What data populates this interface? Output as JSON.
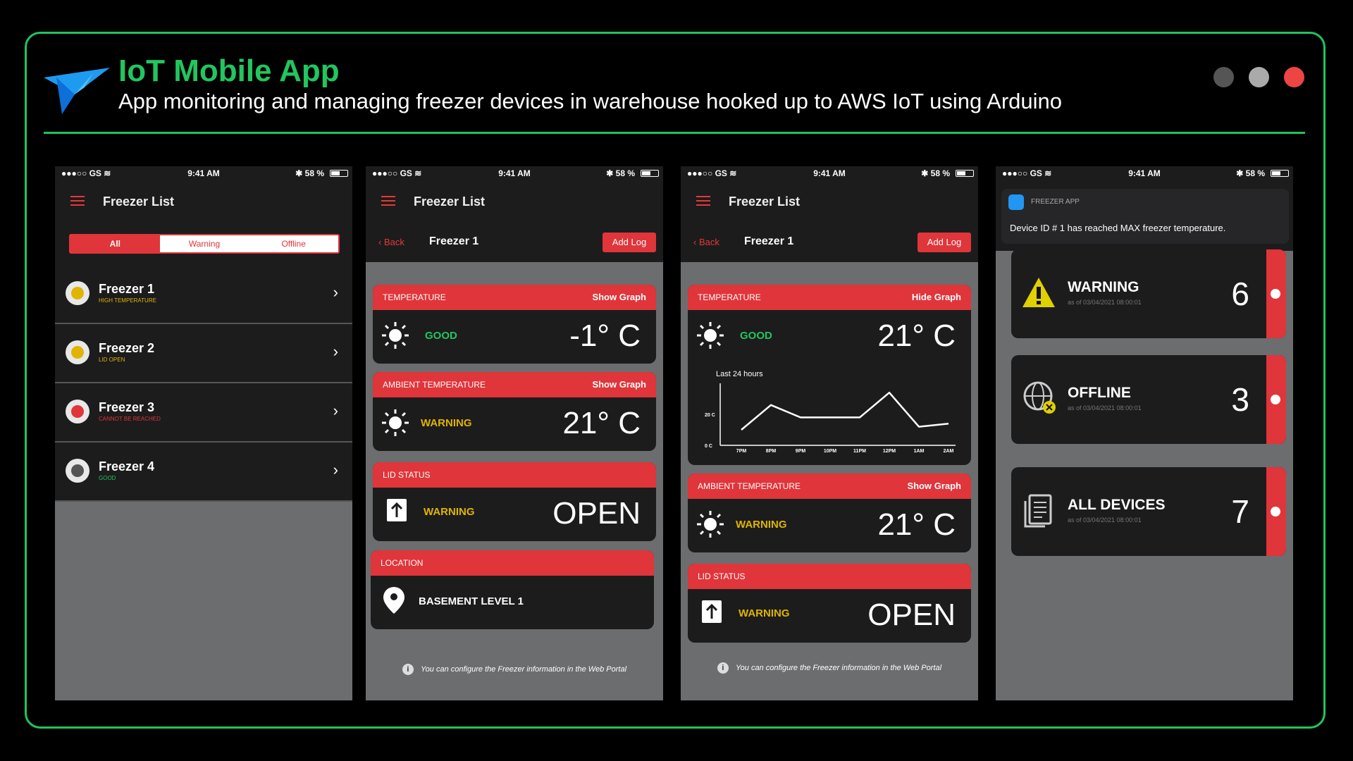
{
  "header": {
    "title": "IoT Mobile App",
    "subtitle": "App monitoring and managing freezer devices in warehouse hooked up to AWS IoT using Arduino",
    "accent_color": "#22c55e",
    "window_dots": [
      "#555555",
      "#aaaaaa",
      "#ef4444"
    ]
  },
  "statusbar": {
    "carrier": "●●●○○ GS ≋",
    "time": "9:41 AM",
    "battery": "✱ 58 %"
  },
  "screen1": {
    "nav_title": "Freezer List",
    "segments": [
      "All",
      "Warning",
      "Offline"
    ],
    "freezers": [
      {
        "name": "Freezer 1",
        "status": "HIGH TEMPERATURE",
        "status_color": "#e0b400",
        "icon": "warning-icon"
      },
      {
        "name": "Freezer 2",
        "status": "LID OPEN",
        "status_color": "#e0b400",
        "icon": "warning-icon"
      },
      {
        "name": "Freezer 3",
        "status": "CANNOT BE REACHED",
        "status_color": "#e0353a",
        "icon": "offline-icon"
      },
      {
        "name": "Freezer 4",
        "status": "GOOD",
        "status_color": "#22c55e",
        "icon": "check-icon"
      }
    ]
  },
  "detail": {
    "nav_title": "Freezer List",
    "back": "Back",
    "device": "Freezer 1",
    "add_log": "Add Log",
    "info": "You can configure the Freezer information in the Web Portal"
  },
  "screen2": {
    "temperature": {
      "title": "TEMPERATURE",
      "graph_label": "Show Graph",
      "status": "GOOD",
      "value": "-1° C"
    },
    "ambient": {
      "title": "AMBIENT TEMPERATURE",
      "graph_label": "Show Graph",
      "status": "WARNING",
      "value": "21° C"
    },
    "lid": {
      "title": "LID STATUS",
      "status": "WARNING",
      "value": "OPEN"
    },
    "location": {
      "title": "LOCATION",
      "value": "BASEMENT LEVEL 1"
    }
  },
  "screen3": {
    "temperature": {
      "title": "TEMPERATURE",
      "graph_label": "Hide Graph",
      "status": "GOOD",
      "value": "21° C"
    },
    "ambient": {
      "title": "AMBIENT TEMPERATURE",
      "graph_label": "Show Graph",
      "status": "WARNING",
      "value": "21° C"
    },
    "lid": {
      "title": "LID STATUS",
      "status": "WARNING",
      "value": "OPEN"
    }
  },
  "chart_data": {
    "type": "line",
    "title": "Last 24 hours",
    "categories": [
      "7PM",
      "8PM",
      "9PM",
      "10PM",
      "11PM",
      "12PM",
      "1AM",
      "2AM"
    ],
    "y_ticks": [
      "20 C",
      "0 C"
    ],
    "series": [
      {
        "values": [
          10,
          26,
          18,
          18,
          18,
          34,
          12,
          14
        ]
      }
    ],
    "ylim": [
      0,
      40
    ]
  },
  "screen4": {
    "notification": {
      "app": "FREEZER APP",
      "message": "Device ID # 1 has reached MAX freezer temperature."
    },
    "summary": [
      {
        "label": "WARNING",
        "as_of": "as of 03/04/2021 08:00:01",
        "count": "6",
        "icon": "warning-icon"
      },
      {
        "label": "OFFLINE",
        "as_of": "as of 03/04/2021 08:00:01",
        "count": "3",
        "icon": "globe-offline-icon"
      },
      {
        "label": "ALL DEVICES",
        "as_of": "as of 03/04/2021 08:00:01",
        "count": "7",
        "icon": "device-list-icon"
      }
    ]
  }
}
